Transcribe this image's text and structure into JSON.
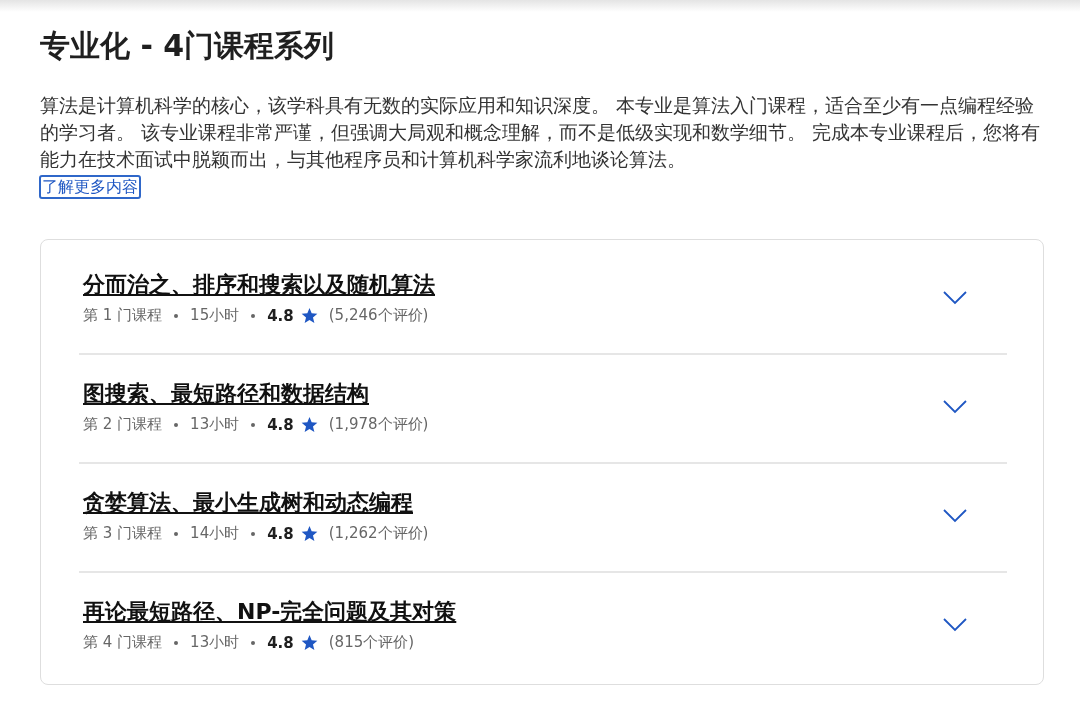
{
  "title": "专业化 - 4门课程系列",
  "description": "算法是计算机科学的核心，该学科具有无数的实际应用和知识深度。 本专业是算法入门课程，适合至少有一点编程经验的学习者。 该专业课程非常严谨，但强调大局观和概念理解，而不是低级实现和数学细节。 完成本专业课程后，您将有能力在技术面试中脱颖而出，与其他程序员和计算机科学家流利地谈论算法。",
  "learn_more": "了解更多内容",
  "courses": [
    {
      "title": "分而治之、排序和搜索以及随机算法",
      "number": "第 1 门课程",
      "hours": "15小时",
      "rating": "4.8",
      "reviews": "(5,246个评价)",
      "expanded": false
    },
    {
      "title": "图搜索、最短路径和数据结构",
      "number": "第 2 门课程",
      "hours": "13小时",
      "rating": "4.8",
      "reviews": "(1,978个评价)",
      "expanded": false
    },
    {
      "title": "贪婪算法、最小生成树和动态编程",
      "number": "第 3 门课程",
      "hours": "14小时",
      "rating": "4.8",
      "reviews": "(1,262个评价)",
      "expanded": false
    },
    {
      "title": "再论最短路径、NP-完全问题及其对策",
      "number": "第 4 门课程",
      "hours": "13小时",
      "rating": "4.8",
      "reviews": "(815个评价)",
      "expanded": false
    }
  ]
}
